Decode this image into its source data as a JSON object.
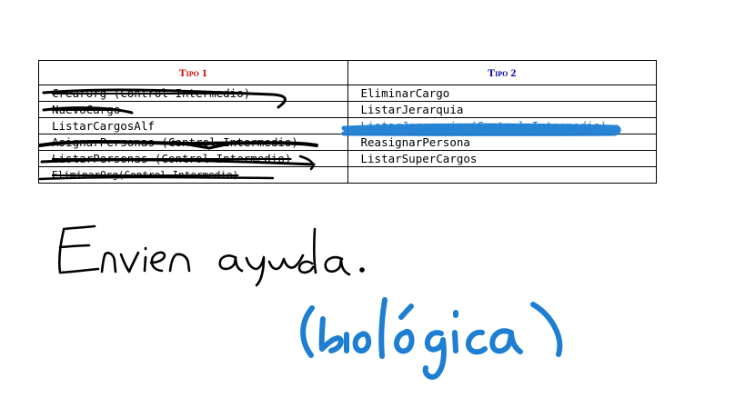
{
  "table": {
    "headers": [
      "Tipo 1",
      "Tipo 2"
    ],
    "header_colors": [
      "#cc0000",
      "#0000aa"
    ],
    "rows": [
      {
        "left": "CrearOrg (Control Intermedio)",
        "right": "EliminarCargo"
      },
      {
        "left": "NuevoCargo",
        "right": "ListarJerarquia"
      },
      {
        "left": "ListarCargosAlf",
        "right": "ListarJerarquia (Control Intermedio)"
      },
      {
        "left": "AsignarPersonas (Control Intermedio)",
        "right": "ReasignarPersona"
      },
      {
        "left": "ListarPersonas (Control Intermedio)",
        "right": "ListarSuperCargos"
      },
      {
        "left": "EliminarOrg(Control Intermedio)",
        "right": ""
      }
    ]
  },
  "handwriting": {
    "line1": "Envien ayuda.",
    "line1_color": "#000000",
    "line2": "(biológica)",
    "line2_color": "#1e7fd2"
  }
}
